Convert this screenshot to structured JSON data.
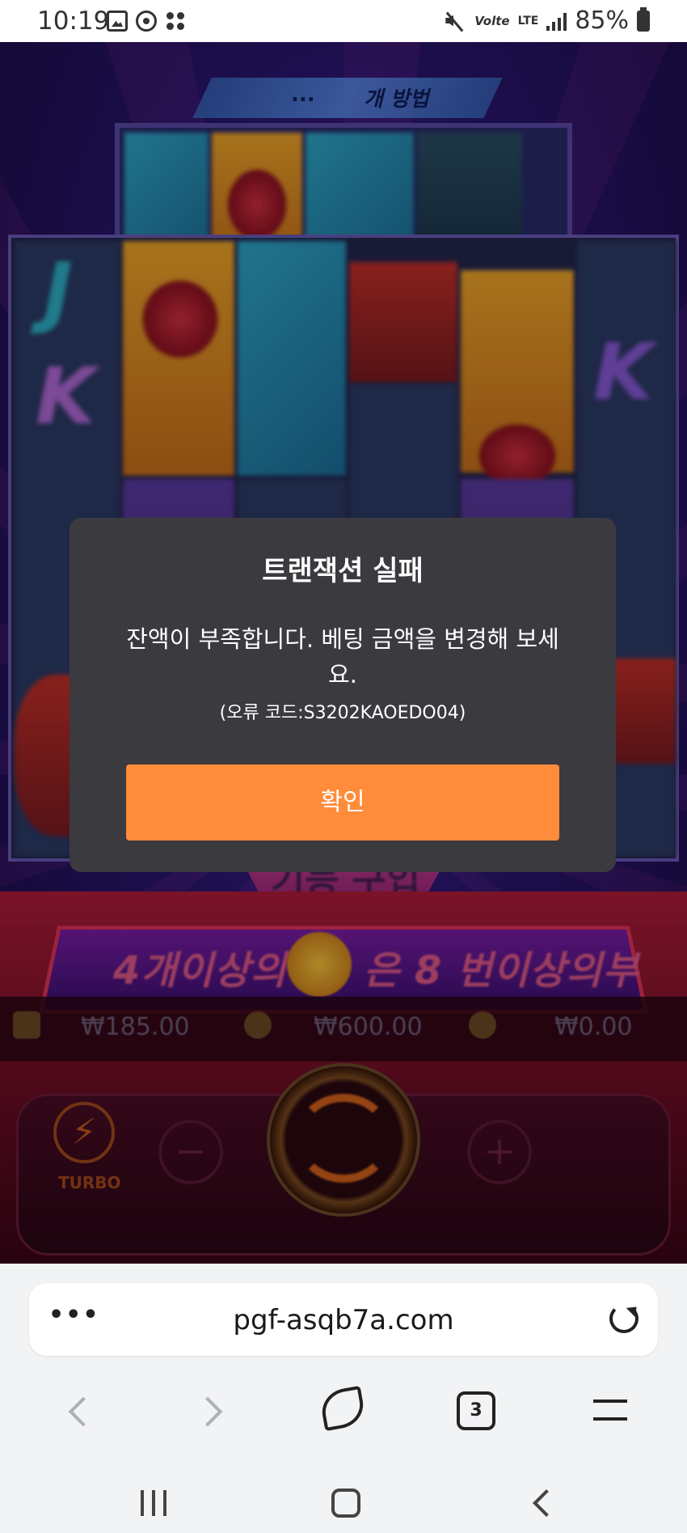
{
  "status_bar": {
    "time": "10:19",
    "battery": "85%",
    "network": "LTE",
    "volte": "Volte",
    "icons": [
      "photo-icon",
      "circle-app-icon",
      "dots-app-icon",
      "mute-icon",
      "volte-icon",
      "lte-icon",
      "signal-icon",
      "battery-icon"
    ]
  },
  "game": {
    "top_banner": "개 방법",
    "top_banner_prefix": "...",
    "feature_buy": "기능 구입",
    "scatter_banner_left": "4개이상의",
    "scatter_banner_right": "은 8 번이상의부",
    "balances": [
      {
        "icon": "wallet-icon",
        "value": "₩185.00"
      },
      {
        "icon": "coins-icon",
        "value": "₩600.00"
      },
      {
        "icon": "win-icon",
        "value": "₩0.00"
      }
    ],
    "turbo_label": "TURBO",
    "minus_label": "−",
    "plus_label": "+",
    "reel_letters": [
      "J",
      "K",
      "K"
    ]
  },
  "modal": {
    "title": "트랜잭션 실패",
    "message": "잔액이 부족합니다. 베팅 금액을 변경해 보세요.",
    "error_code": "(오류 코드:S3202KAOEDO04)",
    "ok_label": "확인"
  },
  "browser": {
    "more_label": "•••",
    "url": "pgf-asqb7a.com",
    "tab_count": "3"
  },
  "colors": {
    "modal_bg": "#3b3a3f",
    "ok_button": "#ff8c3a",
    "browser_bg": "#f2f3f5"
  }
}
